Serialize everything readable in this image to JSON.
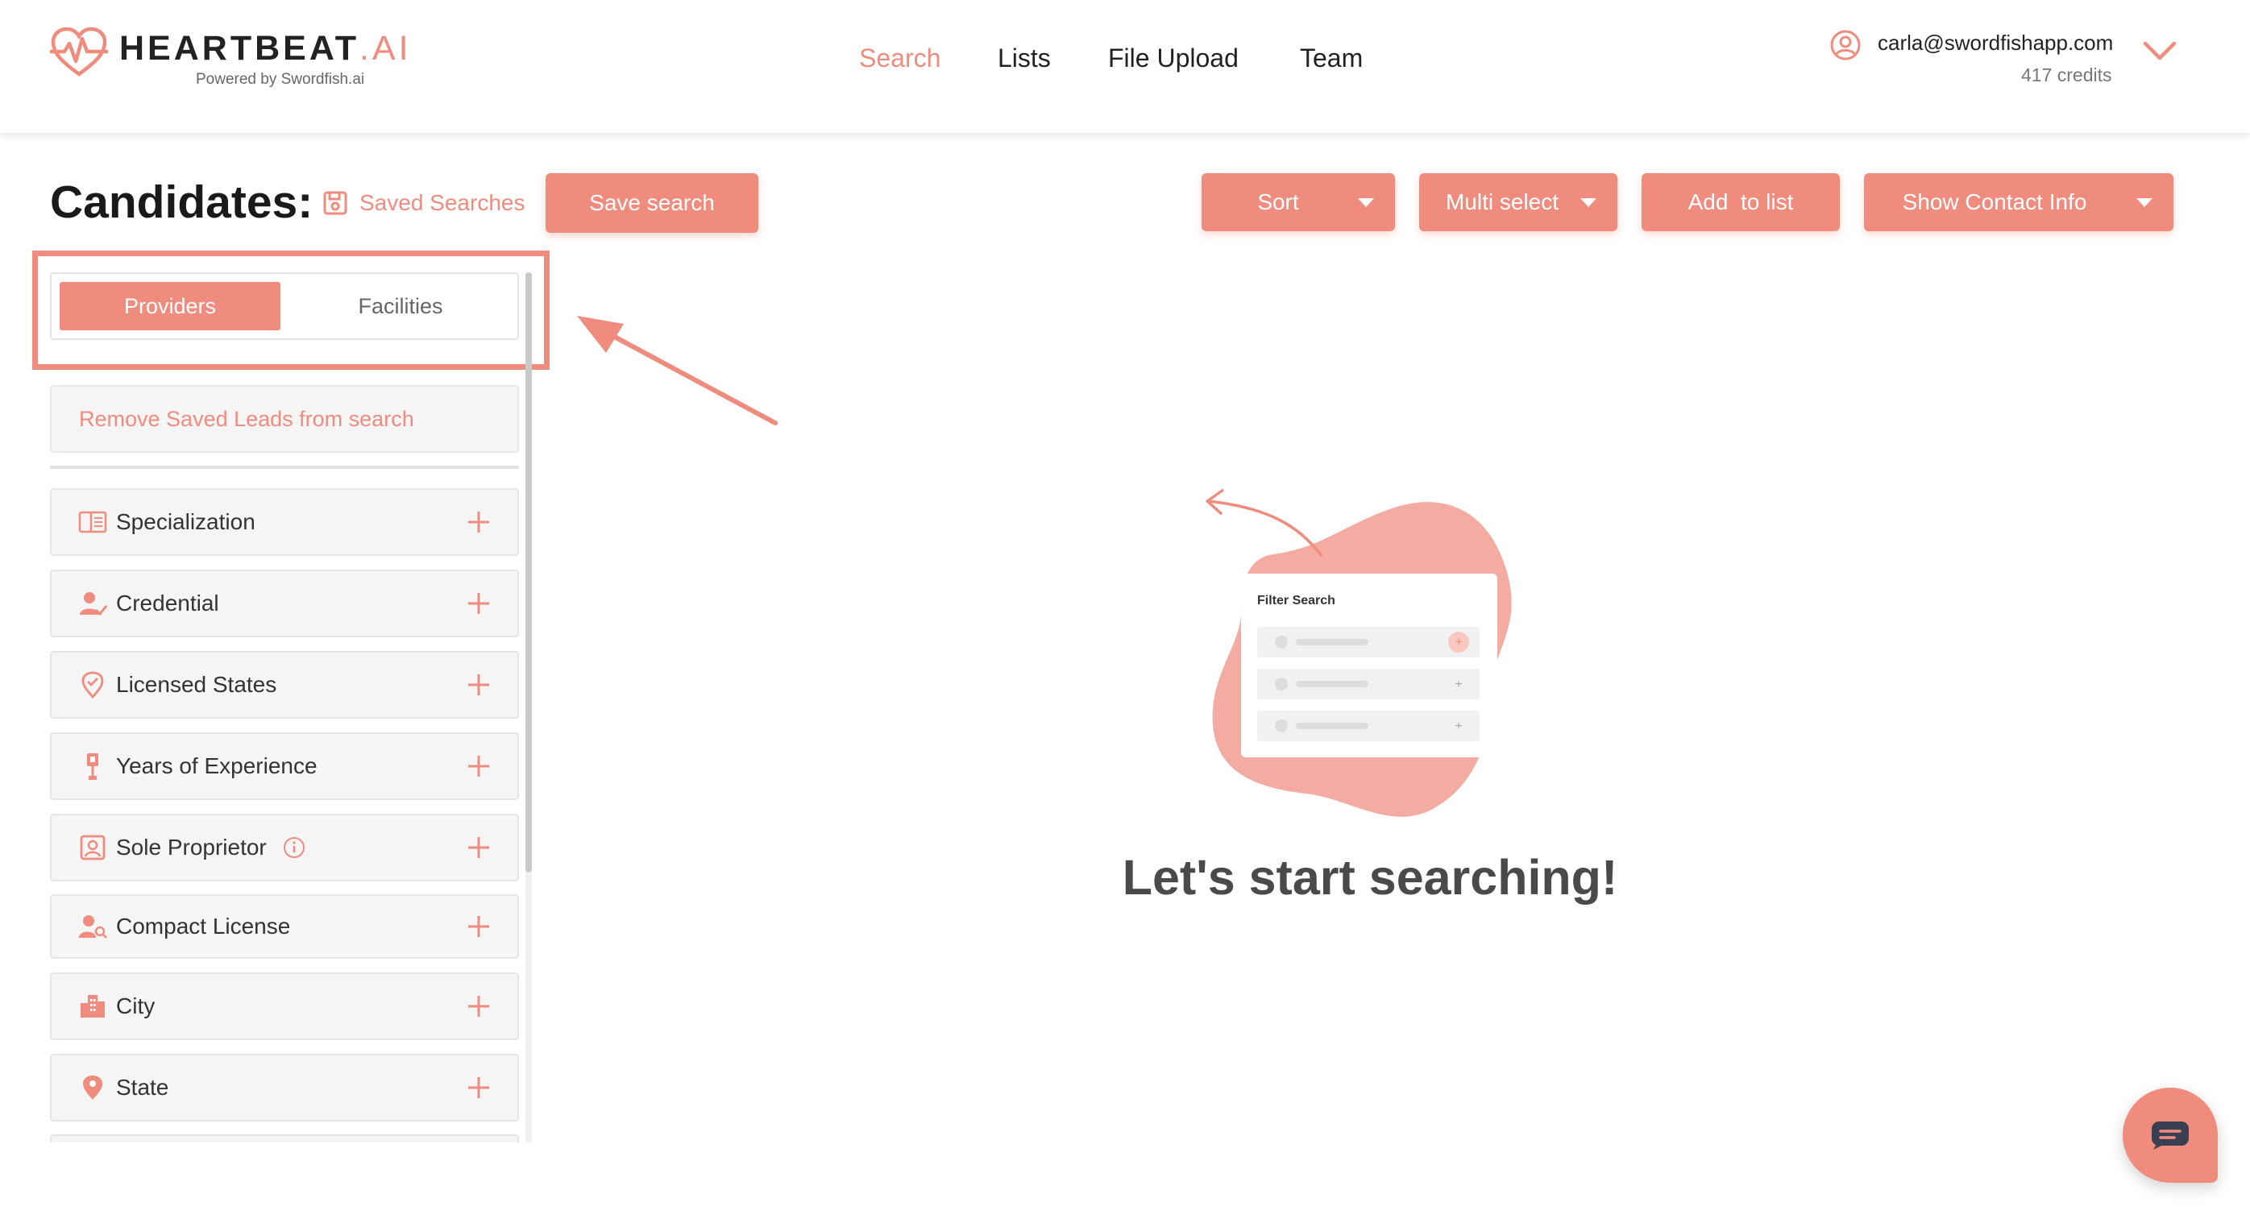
{
  "brand": {
    "name": "HEARTBEAT",
    "suffix": ".AI",
    "tagline": "Powered by Swordfish.ai"
  },
  "nav": {
    "items": [
      {
        "label": "Search",
        "active": true
      },
      {
        "label": "Lists",
        "active": false
      },
      {
        "label": "File Upload",
        "active": false
      },
      {
        "label": "Team",
        "active": false
      }
    ]
  },
  "user": {
    "email": "carla@swordfishapp.com",
    "credits": "417 credits"
  },
  "toolbar": {
    "title": "Candidates:",
    "saved_searches_label": "Saved Searches",
    "save_search_label": "Save search",
    "sort_label": "Sort",
    "multi_select_label": "Multi select",
    "add_to_list_label": "Add  to list",
    "show_contact_label": "Show Contact Info"
  },
  "sidebar": {
    "tabs": [
      {
        "label": "Providers",
        "active": true
      },
      {
        "label": "Facilities",
        "active": false
      }
    ],
    "remove_saved_label": "Remove Saved Leads from search",
    "filters": [
      {
        "label": "Specialization",
        "icon": "specialization-icon"
      },
      {
        "label": "Credential",
        "icon": "credential-icon"
      },
      {
        "label": "Licensed States",
        "icon": "licensed-states-icon"
      },
      {
        "label": "Years of Experience",
        "icon": "experience-icon"
      },
      {
        "label": "Sole Proprietor",
        "icon": "sole-proprietor-icon",
        "info": true
      },
      {
        "label": "Compact License",
        "icon": "compact-license-icon"
      },
      {
        "label": "City",
        "icon": "city-icon"
      },
      {
        "label": "State",
        "icon": "state-icon"
      }
    ]
  },
  "main": {
    "illustration_label": "Filter Search",
    "empty_title": "Let's start searching!"
  },
  "colors": {
    "accent": "#f08c7e",
    "accent_light": "#f4aba1",
    "text_dark": "#222222",
    "panel_bg": "#f5f5f5"
  }
}
